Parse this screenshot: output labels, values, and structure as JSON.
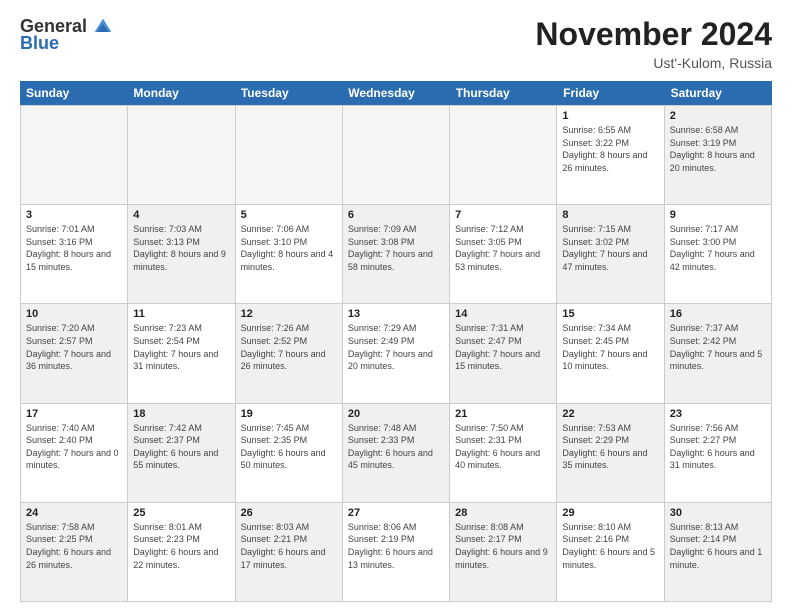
{
  "logo": {
    "general": "General",
    "blue": "Blue"
  },
  "title": "November 2024",
  "location": "Ust'-Kulom, Russia",
  "weekdays": [
    "Sunday",
    "Monday",
    "Tuesday",
    "Wednesday",
    "Thursday",
    "Friday",
    "Saturday"
  ],
  "weeks": [
    [
      {
        "day": "",
        "empty": true
      },
      {
        "day": "",
        "empty": true
      },
      {
        "day": "",
        "empty": true
      },
      {
        "day": "",
        "empty": true
      },
      {
        "day": "",
        "empty": true
      },
      {
        "day": "1",
        "sunrise": "6:55 AM",
        "sunset": "3:22 PM",
        "daylight": "8 hours and 26 minutes."
      },
      {
        "day": "2",
        "sunrise": "6:58 AM",
        "sunset": "3:19 PM",
        "daylight": "8 hours and 20 minutes.",
        "shaded": true
      }
    ],
    [
      {
        "day": "3",
        "sunrise": "7:01 AM",
        "sunset": "3:16 PM",
        "daylight": "8 hours and 15 minutes."
      },
      {
        "day": "4",
        "sunrise": "7:03 AM",
        "sunset": "3:13 PM",
        "daylight": "8 hours and 9 minutes.",
        "shaded": true
      },
      {
        "day": "5",
        "sunrise": "7:06 AM",
        "sunset": "3:10 PM",
        "daylight": "8 hours and 4 minutes."
      },
      {
        "day": "6",
        "sunrise": "7:09 AM",
        "sunset": "3:08 PM",
        "daylight": "7 hours and 58 minutes.",
        "shaded": true
      },
      {
        "day": "7",
        "sunrise": "7:12 AM",
        "sunset": "3:05 PM",
        "daylight": "7 hours and 53 minutes."
      },
      {
        "day": "8",
        "sunrise": "7:15 AM",
        "sunset": "3:02 PM",
        "daylight": "7 hours and 47 minutes.",
        "shaded": true
      },
      {
        "day": "9",
        "sunrise": "7:17 AM",
        "sunset": "3:00 PM",
        "daylight": "7 hours and 42 minutes."
      }
    ],
    [
      {
        "day": "10",
        "sunrise": "7:20 AM",
        "sunset": "2:57 PM",
        "daylight": "7 hours and 36 minutes.",
        "shaded": true
      },
      {
        "day": "11",
        "sunrise": "7:23 AM",
        "sunset": "2:54 PM",
        "daylight": "7 hours and 31 minutes."
      },
      {
        "day": "12",
        "sunrise": "7:26 AM",
        "sunset": "2:52 PM",
        "daylight": "7 hours and 26 minutes.",
        "shaded": true
      },
      {
        "day": "13",
        "sunrise": "7:29 AM",
        "sunset": "2:49 PM",
        "daylight": "7 hours and 20 minutes."
      },
      {
        "day": "14",
        "sunrise": "7:31 AM",
        "sunset": "2:47 PM",
        "daylight": "7 hours and 15 minutes.",
        "shaded": true
      },
      {
        "day": "15",
        "sunrise": "7:34 AM",
        "sunset": "2:45 PM",
        "daylight": "7 hours and 10 minutes."
      },
      {
        "day": "16",
        "sunrise": "7:37 AM",
        "sunset": "2:42 PM",
        "daylight": "7 hours and 5 minutes.",
        "shaded": true
      }
    ],
    [
      {
        "day": "17",
        "sunrise": "7:40 AM",
        "sunset": "2:40 PM",
        "daylight": "7 hours and 0 minutes."
      },
      {
        "day": "18",
        "sunrise": "7:42 AM",
        "sunset": "2:37 PM",
        "daylight": "6 hours and 55 minutes.",
        "shaded": true
      },
      {
        "day": "19",
        "sunrise": "7:45 AM",
        "sunset": "2:35 PM",
        "daylight": "6 hours and 50 minutes."
      },
      {
        "day": "20",
        "sunrise": "7:48 AM",
        "sunset": "2:33 PM",
        "daylight": "6 hours and 45 minutes.",
        "shaded": true
      },
      {
        "day": "21",
        "sunrise": "7:50 AM",
        "sunset": "2:31 PM",
        "daylight": "6 hours and 40 minutes."
      },
      {
        "day": "22",
        "sunrise": "7:53 AM",
        "sunset": "2:29 PM",
        "daylight": "6 hours and 35 minutes.",
        "shaded": true
      },
      {
        "day": "23",
        "sunrise": "7:56 AM",
        "sunset": "2:27 PM",
        "daylight": "6 hours and 31 minutes."
      }
    ],
    [
      {
        "day": "24",
        "sunrise": "7:58 AM",
        "sunset": "2:25 PM",
        "daylight": "6 hours and 26 minutes.",
        "shaded": true
      },
      {
        "day": "25",
        "sunrise": "8:01 AM",
        "sunset": "2:23 PM",
        "daylight": "6 hours and 22 minutes."
      },
      {
        "day": "26",
        "sunrise": "8:03 AM",
        "sunset": "2:21 PM",
        "daylight": "6 hours and 17 minutes.",
        "shaded": true
      },
      {
        "day": "27",
        "sunrise": "8:06 AM",
        "sunset": "2:19 PM",
        "daylight": "6 hours and 13 minutes."
      },
      {
        "day": "28",
        "sunrise": "8:08 AM",
        "sunset": "2:17 PM",
        "daylight": "6 hours and 9 minutes.",
        "shaded": true
      },
      {
        "day": "29",
        "sunrise": "8:10 AM",
        "sunset": "2:16 PM",
        "daylight": "6 hours and 5 minutes."
      },
      {
        "day": "30",
        "sunrise": "8:13 AM",
        "sunset": "2:14 PM",
        "daylight": "6 hours and 1 minute.",
        "shaded": true
      }
    ]
  ]
}
